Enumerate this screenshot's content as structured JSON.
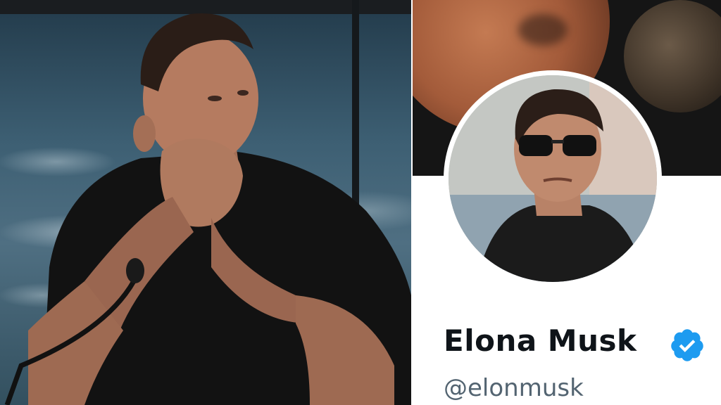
{
  "profile": {
    "display_name": "Elona Musk",
    "handle": "@elonmusk",
    "verified": true
  },
  "icons": {
    "verified": "verified-badge-icon",
    "microphone": "microphone-icon"
  },
  "colors": {
    "verified_blue": "#1d9bf0",
    "name_text": "#0f1419",
    "handle_text": "#536471",
    "banner_mars": "#a35b3a"
  }
}
